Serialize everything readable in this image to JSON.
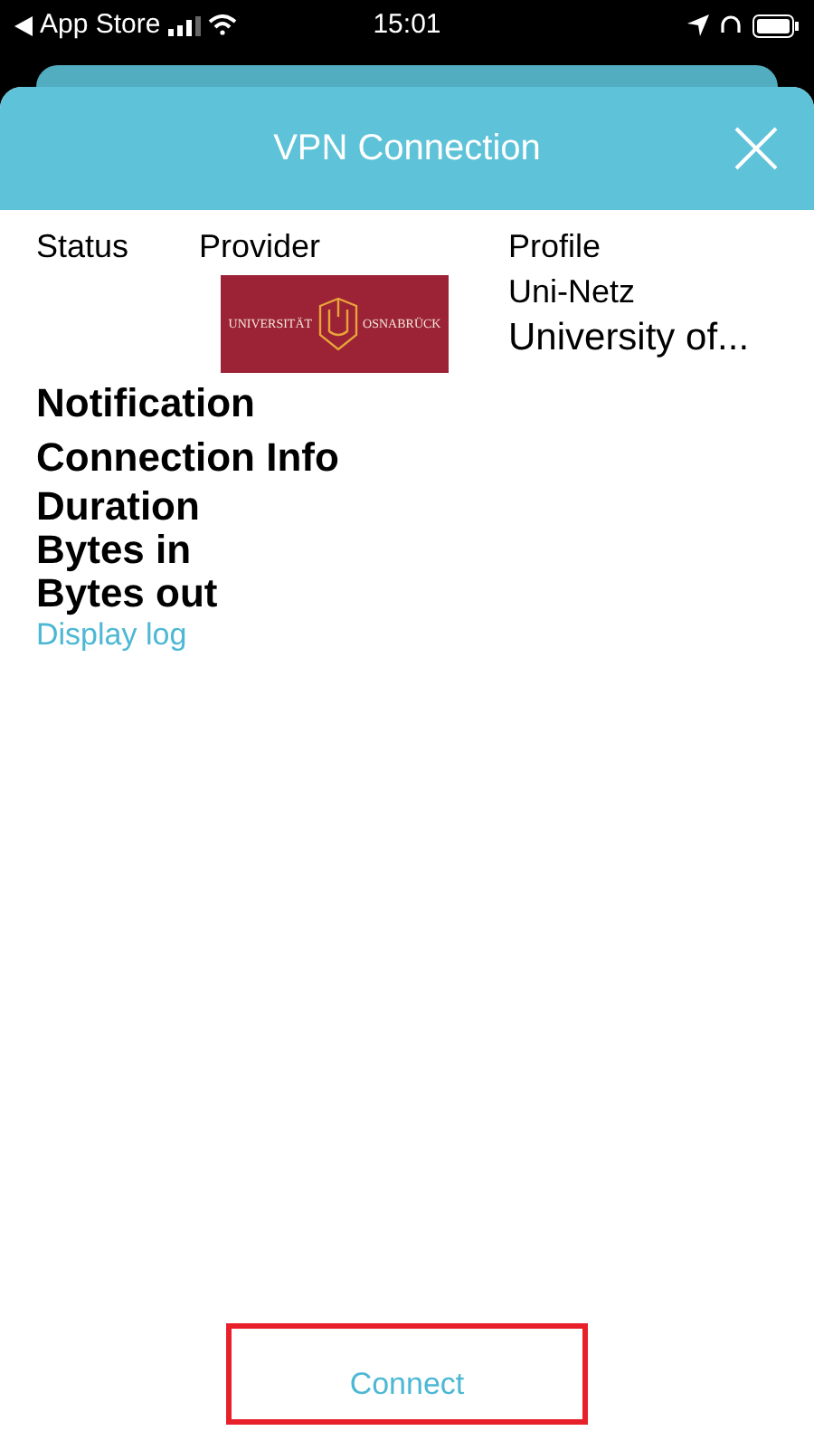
{
  "status_bar": {
    "back_label": "App Store",
    "time": "15:01"
  },
  "sheet": {
    "title": "VPN Connection"
  },
  "columns": [
    {
      "kind": "status",
      "label": "Status"
    },
    {
      "kind": "provider",
      "label": "Provider",
      "logo": {
        "left": "UNIVERSITÄT",
        "right": "OSNABRÜCK"
      }
    },
    {
      "kind": "profile",
      "label": "Profile",
      "name": "Uni-Netz",
      "description": "University of..."
    }
  ],
  "sections": [
    {
      "kind": "heading",
      "text": "Notification"
    },
    {
      "kind": "heading",
      "text": "Connection Info"
    },
    {
      "kind": "item",
      "text": "Duration"
    },
    {
      "kind": "item",
      "text": "Bytes in"
    },
    {
      "kind": "item",
      "text": "Bytes out"
    }
  ],
  "display_log_link": "Display log",
  "connect_button": "Connect"
}
